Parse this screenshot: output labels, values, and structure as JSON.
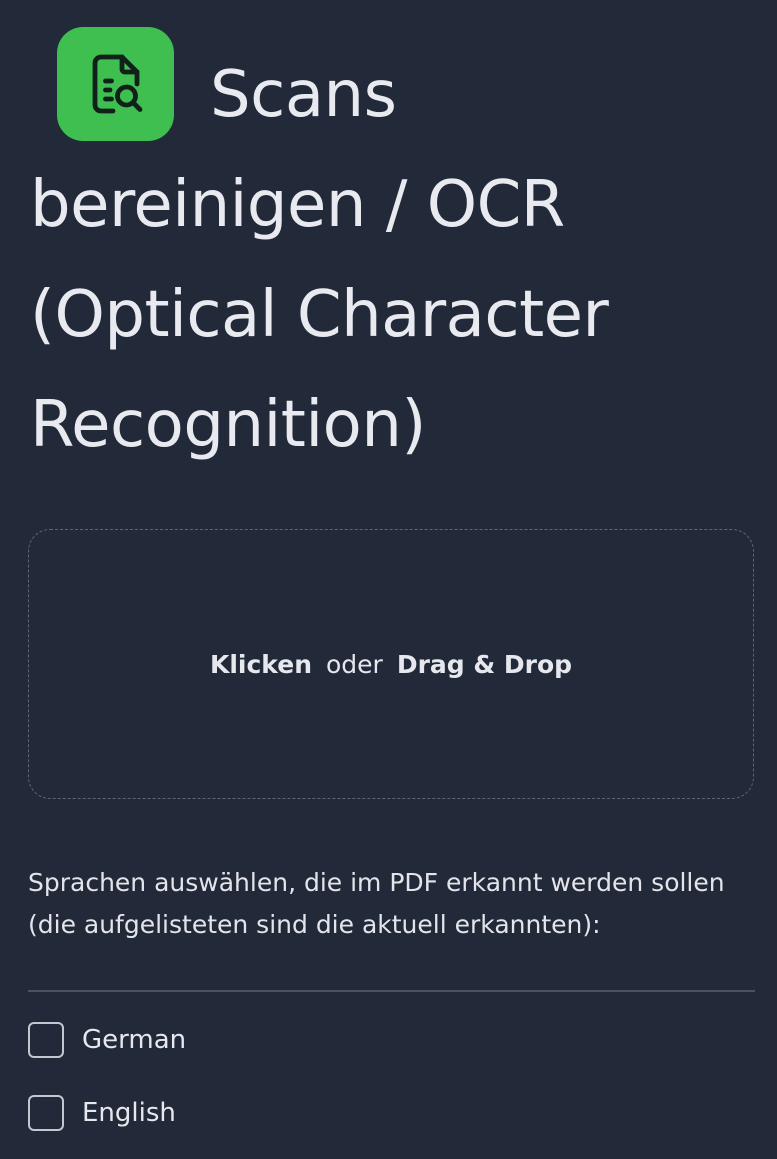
{
  "header": {
    "icon": "document-search-icon",
    "icon_color": "#3fbf4f",
    "title": "Scans bereinigen / OCR (Optical Character Recognition)"
  },
  "dropzone": {
    "click_label": "Klicken",
    "separator": "oder",
    "drag_label": "Drag & Drop"
  },
  "language_section": {
    "instructions": "Sprachen auswählen, die im PDF erkannt werden sollen (die aufgelisteten sind die aktuell erkannten):",
    "languages": [
      {
        "label": "German",
        "checked": false
      },
      {
        "label": "English",
        "checked": false
      }
    ]
  },
  "colors": {
    "background": "#222938",
    "text": "#e6e8ee",
    "accent": "#3fbf4f"
  }
}
